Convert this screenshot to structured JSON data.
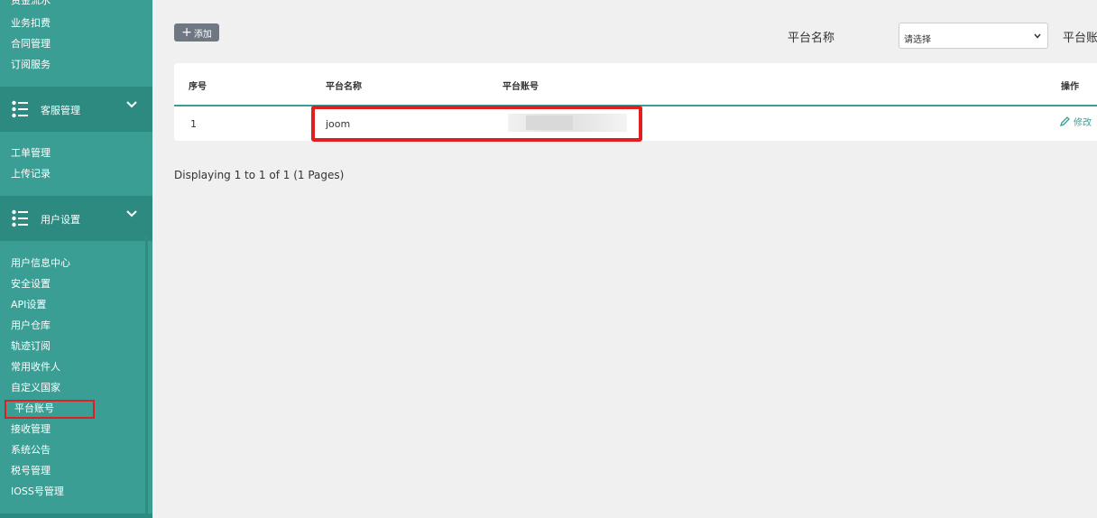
{
  "sidebar": {
    "top_links": [
      "资金流水",
      "业务扣费",
      "合同管理",
      "订阅服务"
    ],
    "sections": [
      {
        "label": "客服管理",
        "links": [
          "工单管理",
          "上传记录"
        ]
      },
      {
        "label": "用户设置",
        "links": [
          "用户信息中心",
          "安全设置",
          "API设置",
          "用户仓库",
          "轨迹订阅",
          "常用收件人",
          "自定义国家",
          "平台账号",
          "接收管理",
          "系统公告",
          "税号管理",
          "IOSS号管理"
        ]
      }
    ],
    "active_item": "平台账号"
  },
  "toolbar": {
    "add_label": "添加",
    "filter_label": "平台名称",
    "filter_placeholder": "请选择",
    "filter_label_2": "平台账"
  },
  "table": {
    "headers": [
      "序号",
      "平台名称",
      "平台账号",
      "操作"
    ],
    "rows": [
      {
        "index": "1",
        "platform": "joom",
        "account": "",
        "action": "修改"
      }
    ]
  },
  "footer": {
    "info": "Displaying 1 to 1 of 1 (1 Pages)"
  },
  "colors": {
    "sidebar_bg": "#3a9e94",
    "section_bg": "#2d8a80",
    "accent": "#3a9e94",
    "highlight": "#e02020"
  }
}
